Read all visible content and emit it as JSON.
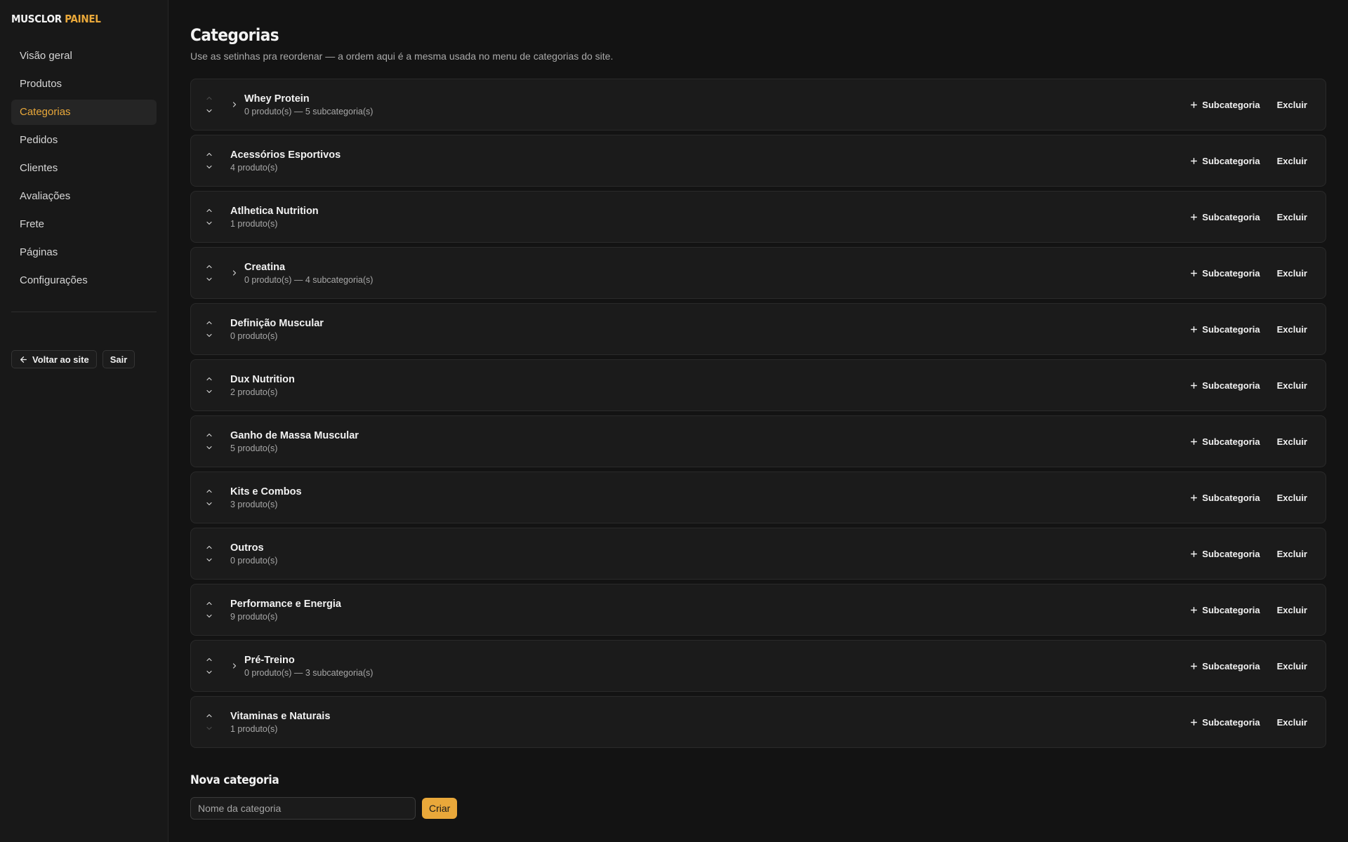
{
  "brand": {
    "part1": "MUSCLOR",
    "part2": "PAINEL"
  },
  "nav": [
    {
      "label": "Visão geral",
      "active": false
    },
    {
      "label": "Produtos",
      "active": false
    },
    {
      "label": "Categorias",
      "active": true
    },
    {
      "label": "Pedidos",
      "active": false
    },
    {
      "label": "Clientes",
      "active": false
    },
    {
      "label": "Avaliações",
      "active": false
    },
    {
      "label": "Frete",
      "active": false
    },
    {
      "label": "Páginas",
      "active": false
    },
    {
      "label": "Configurações",
      "active": false
    }
  ],
  "sidebar_actions": {
    "back_label": "Voltar ao site",
    "logout_label": "Sair"
  },
  "page": {
    "title": "Categorias",
    "subtitle": "Use as setinhas pra reordenar — a ordem aqui é a mesma usada no menu de categorias do site."
  },
  "row_actions": {
    "add_sub_label": "Subcategoria",
    "delete_label": "Excluir"
  },
  "categories": [
    {
      "name": "Whey Protein",
      "meta": "0 produto(s) — 5 subcategoria(s)",
      "expandable": true,
      "up_disabled": true,
      "down_disabled": false
    },
    {
      "name": "Acessórios Esportivos",
      "meta": "4 produto(s)",
      "expandable": false,
      "up_disabled": false,
      "down_disabled": false
    },
    {
      "name": "Atlhetica Nutrition",
      "meta": "1 produto(s)",
      "expandable": false,
      "up_disabled": false,
      "down_disabled": false
    },
    {
      "name": "Creatina",
      "meta": "0 produto(s) — 4 subcategoria(s)",
      "expandable": true,
      "up_disabled": false,
      "down_disabled": false
    },
    {
      "name": "Definição Muscular",
      "meta": "0 produto(s)",
      "expandable": false,
      "up_disabled": false,
      "down_disabled": false
    },
    {
      "name": "Dux Nutrition",
      "meta": "2 produto(s)",
      "expandable": false,
      "up_disabled": false,
      "down_disabled": false
    },
    {
      "name": "Ganho de Massa Muscular",
      "meta": "5 produto(s)",
      "expandable": false,
      "up_disabled": false,
      "down_disabled": false
    },
    {
      "name": "Kits e Combos",
      "meta": "3 produto(s)",
      "expandable": false,
      "up_disabled": false,
      "down_disabled": false
    },
    {
      "name": "Outros",
      "meta": "0 produto(s)",
      "expandable": false,
      "up_disabled": false,
      "down_disabled": false
    },
    {
      "name": "Performance e Energia",
      "meta": "9 produto(s)",
      "expandable": false,
      "up_disabled": false,
      "down_disabled": false
    },
    {
      "name": "Pré-Treino",
      "meta": "0 produto(s) — 3 subcategoria(s)",
      "expandable": true,
      "up_disabled": false,
      "down_disabled": false
    },
    {
      "name": "Vitaminas e Naturais",
      "meta": "1 produto(s)",
      "expandable": false,
      "up_disabled": false,
      "down_disabled": true
    }
  ],
  "new_category": {
    "title": "Nova categoria",
    "placeholder": "Nome da categoria",
    "value": "",
    "create_label": "Criar"
  },
  "colors": {
    "accent": "#e9a83a",
    "background": "#131313",
    "sidebar": "#181818",
    "row": "#1b1b1b"
  },
  "icons": {
    "up": "chevron-up-icon",
    "down": "chevron-down-icon",
    "expand": "chevron-right-icon",
    "add": "plus-icon",
    "back": "arrow-left-icon"
  }
}
